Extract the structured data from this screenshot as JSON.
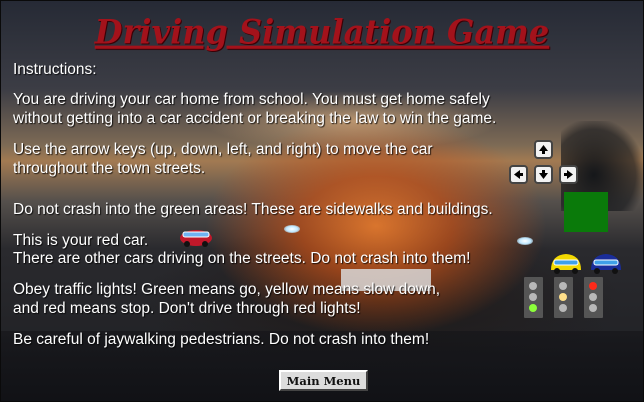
{
  "title": "Driving Simulation Game",
  "instructions": {
    "heading": "Instructions:",
    "intro_line1": "You are driving your car home from school. You must get home safely",
    "intro_line2": "without getting into a car accident or breaking the law to win the game.",
    "arrows_line1": "Use the arrow keys (up, down, left, and right) to move the car",
    "arrows_line2": "throughout the town streets.",
    "green_line": "Do not crash into the green areas! These are sidewalks and buildings.",
    "red_car_line": "This is your red car.",
    "other_cars_line": "There are other cars driving on the streets. Do not crash into them!",
    "lights_line1": "Obey traffic lights! Green means go, yellow means slow down,",
    "lights_line2": "and red means stop. Don't drive through red lights!",
    "pedestrians_line": "Be careful of jaywalking pedestrians. Do not crash into them!"
  },
  "icons": {
    "arrow_keys": [
      "arrow-up-key-icon",
      "arrow-left-key-icon",
      "arrow-down-key-icon",
      "arrow-right-key-icon"
    ],
    "player_car": "red-car-icon",
    "other_cars": [
      "yellow-car-icon",
      "blue-car-icon"
    ],
    "traffic_lights": [
      "traffic-light-green-icon",
      "traffic-light-yellow-icon",
      "traffic-light-red-icon"
    ]
  },
  "colors": {
    "title": "#a3121b",
    "green_area": "#0a7a0a",
    "player_car": "#c0182a",
    "yellow_car": "#f2d800",
    "blue_car": "#1a2d9a",
    "light_green": "#8cff3a",
    "light_yellow": "#ffe08a",
    "light_red": "#ff2a1a",
    "light_off": "#b8b8b8"
  },
  "main_menu_label": "Main Menu"
}
